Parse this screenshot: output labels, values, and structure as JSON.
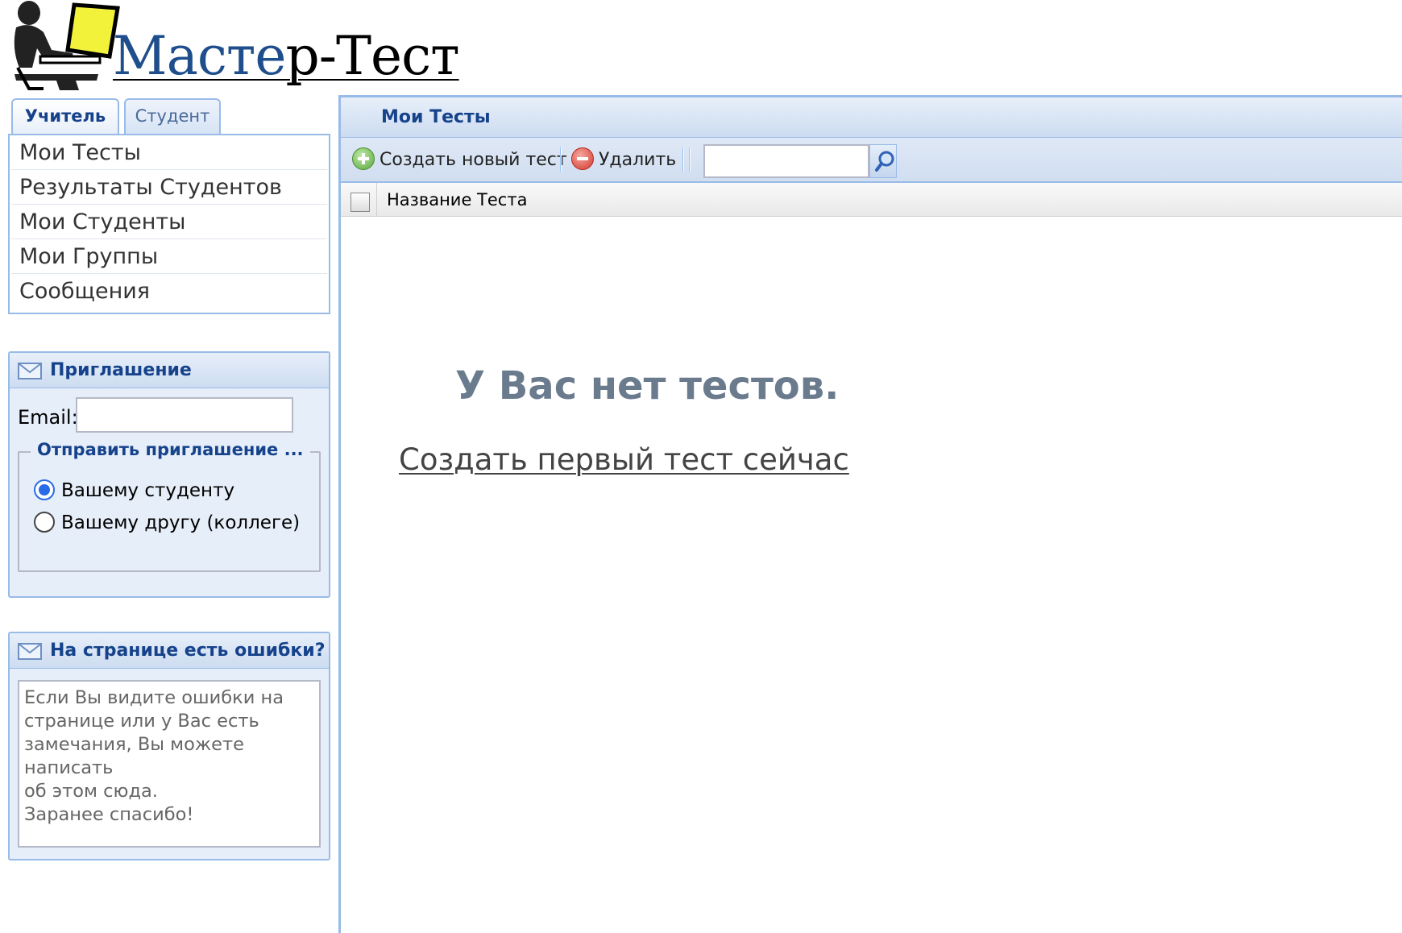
{
  "header": {
    "logo_text_blue": "Масте",
    "logo_text_black": "р-Тест"
  },
  "tabs": [
    {
      "label": "Учитель",
      "active": true
    },
    {
      "label": "Студент",
      "active": false
    }
  ],
  "sidebar": {
    "items": [
      {
        "label": "Мои Тесты"
      },
      {
        "label": "Результаты Студентов"
      },
      {
        "label": "Мои Студенты"
      },
      {
        "label": "Мои Группы"
      },
      {
        "label": "Сообщения"
      }
    ]
  },
  "invite": {
    "title": "Приглашение",
    "email_label": "Email:",
    "email_value": "",
    "legend": "Отправить приглашение ...",
    "options": [
      {
        "label": "Вашему студенту",
        "checked": true
      },
      {
        "label": "Вашему другу (коллеге)",
        "checked": false
      }
    ]
  },
  "feedback": {
    "title": "На странице есть ошибки?",
    "text": "Если Вы видите ошибки на\nстранице или у Вас есть\nзамечания, Вы можете написать\nоб этом сюда.\nЗаранее спасибо!"
  },
  "main": {
    "title": "Мои Тесты",
    "toolbar": {
      "create_label": "Создать новый тест",
      "delete_label": "Удалить",
      "search_value": ""
    },
    "grid": {
      "columns": [
        "Название Теста"
      ]
    },
    "empty_message": "У Вас нет тестов.",
    "create_link": "Создать первый тест сейчас"
  },
  "colors": {
    "accent": "#15428b",
    "border": "#99bbe8",
    "panel_bg": "#e6eef9"
  }
}
